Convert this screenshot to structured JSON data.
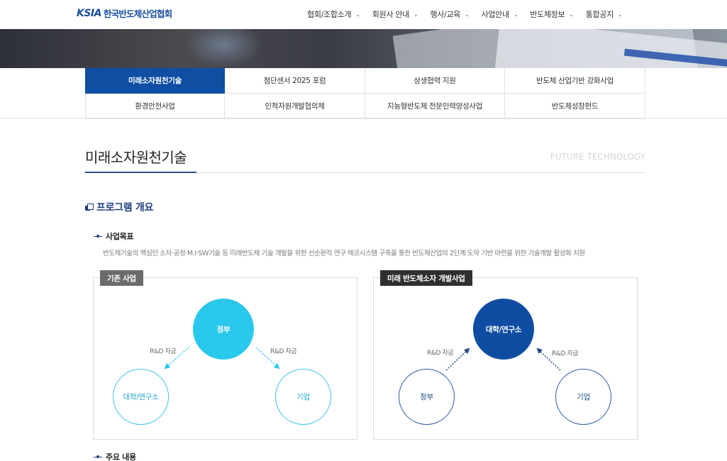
{
  "header": {
    "logo_mark": "KSIA",
    "logo_text": "한국반도체산업협회",
    "menu": [
      {
        "label": "협회/조합소개"
      },
      {
        "label": "회원사 안내"
      },
      {
        "label": "행사/교육"
      },
      {
        "label": "사업안내"
      },
      {
        "label": "반도체정보"
      },
      {
        "label": "통합공지"
      }
    ]
  },
  "subnav": {
    "items": [
      {
        "label": "미래소자원천기술",
        "active": true
      },
      {
        "label": "첨단센서 2025 포럼"
      },
      {
        "label": "상생협력 지원"
      },
      {
        "label": "반도체 산업기반 강화사업"
      },
      {
        "label": "환경안전사업"
      },
      {
        "label": "인적자원개발협의체"
      },
      {
        "label": "지능형반도체 전문인력양성사업"
      },
      {
        "label": "반도체성장펀드"
      }
    ]
  },
  "page": {
    "title": "미래소자원천기술",
    "subtitle": "FUTURE TECHNOLOGY"
  },
  "section": {
    "title": "프로그램 개요",
    "goal_heading": "사업목표",
    "goal_text": "반도체기술의 핵심인 소자·공정·M.I·SW기술 등 미래반도체 기술 개발을 위한 선순환적 연구 에코시스템 구축을 통한 반도체산업의 2단계 도약 기반 마련을 위한 기술개발 활성화 지원",
    "content_heading": "주요 내용"
  },
  "diagram_existing": {
    "label": "기존 사업",
    "top": "정부",
    "left": "대학/연구소",
    "right": "기업",
    "left_flow": "R&D 자금",
    "right_flow": "R&D 자금"
  },
  "diagram_future": {
    "label": "미래 반도체소자 개발사업",
    "top": "대학/연구소",
    "left": "정부",
    "right": "기업",
    "left_flow": "R&D 자금",
    "right_flow": "R&D 자금"
  },
  "colors": {
    "brand": "#0e4ea3",
    "cyan": "#29c8ec",
    "navy": "#0e4da1"
  }
}
